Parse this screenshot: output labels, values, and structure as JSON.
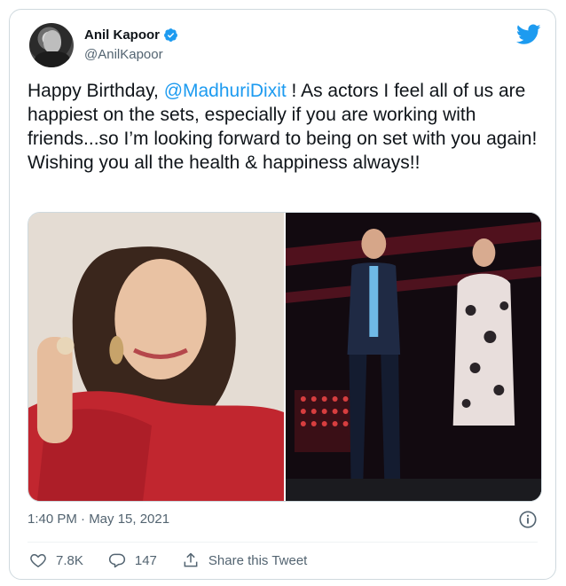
{
  "author": {
    "name": "Anil Kapoor",
    "handle": "@AnilKapoor"
  },
  "tweet": {
    "text_part1": "Happy Birthday, ",
    "mention": "@MadhuriDixit",
    "text_part2": " ! As actors I feel all of us are happiest on the sets, especially if you are working with friends...so I’m looking forward to being on set with you again!",
    "text_line2": "Wishing you all the health & happiness always!!"
  },
  "meta": {
    "timestamp": "1:40 PM · May 15, 2021"
  },
  "actions": {
    "likes": "7.8K",
    "replies": "147",
    "share_label": "Share this Tweet"
  },
  "colors": {
    "accent": "#1d9bf0",
    "muted": "#536471"
  },
  "icons": {
    "verified": "verified-badge-icon",
    "brand": "twitter-bird-icon",
    "info": "info-icon",
    "like": "heart-icon",
    "reply": "reply-icon",
    "share": "share-icon"
  }
}
